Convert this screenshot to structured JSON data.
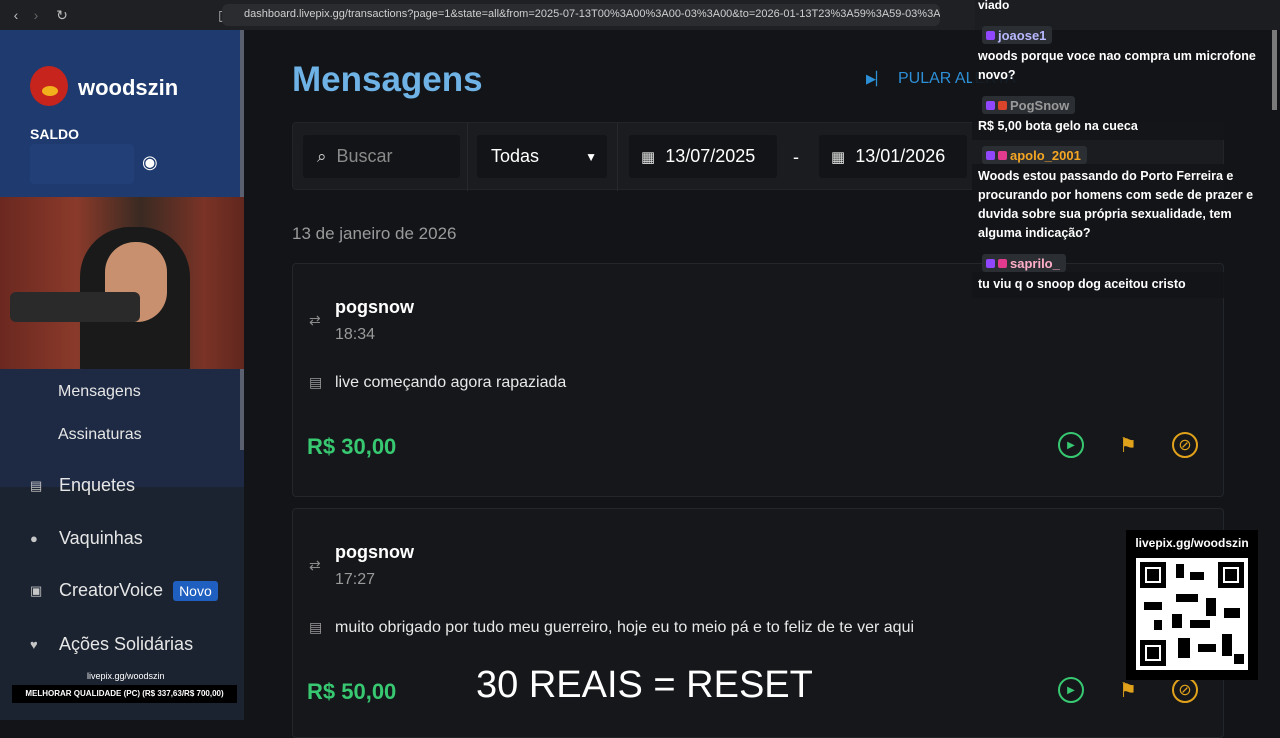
{
  "browser": {
    "url": "dashboard.livepix.gg/transactions?page=1&state=all&from=2025-07-13T00%3A00%3A00-03%3A00&to=2026-01-13T23%3A59%3A59-03%3A..."
  },
  "sidebar": {
    "username": "woodszin",
    "saldo_label": "SALDO",
    "sub_items": [
      "Mensagens",
      "Assinaturas"
    ],
    "items": [
      {
        "label": "Enquetes",
        "icon": "poll-icon"
      },
      {
        "label": "Vaquinhas",
        "icon": "piggy-bank-icon"
      },
      {
        "label": "CreatorVoice",
        "icon": "voice-icon",
        "badge": "Novo"
      },
      {
        "label": "Ações Solidárias",
        "icon": "charity-icon"
      }
    ],
    "overlay_link": "livepix.gg/woodszin",
    "overlay_bar": "MELHORAR QUALIDADE (PC) (R$ 337,63/R$ 700,00)"
  },
  "main": {
    "title": "Mensagens",
    "skip_alert": "PULAR ALERTA",
    "filters": {
      "search_placeholder": "Buscar",
      "state": "Todas",
      "date_from": "13/07/2025",
      "date_sep": "-",
      "date_to": "13/01/2026"
    },
    "date_group": "13 de janeiro de 2026",
    "transactions": [
      {
        "sender": "pogsnow",
        "time": "18:34",
        "message": "live começando agora rapaziada",
        "amount": "R$ 30,00"
      },
      {
        "sender": "pogsnow",
        "time": "17:27",
        "message": "muito obrigado por tudo meu guerreiro, hoje eu to meio pá e to feliz de te ver aqui",
        "amount": "R$ 50,00"
      }
    ]
  },
  "chat": {
    "top_fragment": "viado",
    "messages": [
      {
        "user": "joaose1",
        "color": "#b8b8ff",
        "text": "woods porque voce nao compra um microfone novo?"
      },
      {
        "user": "PogSnow",
        "color": "#9a9a9a",
        "text": "R$ 5,00 bota gelo na cueca"
      },
      {
        "user": "apolo_2001",
        "color": "#f5a623",
        "text": "Woods estou passando do Porto Ferreira e procurando por homens com sede de prazer e duvida sobre sua própria sexualidade, tem alguma indicação?"
      },
      {
        "user": "saprilo_",
        "color": "#ffb0c8",
        "text": "tu viu q o snoop dog aceitou cristo"
      }
    ]
  },
  "qr": {
    "label": "livepix.gg/woodszin"
  },
  "caption": "30 REAIS = RESET",
  "colors": {
    "accent": "#6fb3e6",
    "amount": "#37c871",
    "warn": "#e0a11b",
    "sidebar_top": "#1e3a6e"
  }
}
